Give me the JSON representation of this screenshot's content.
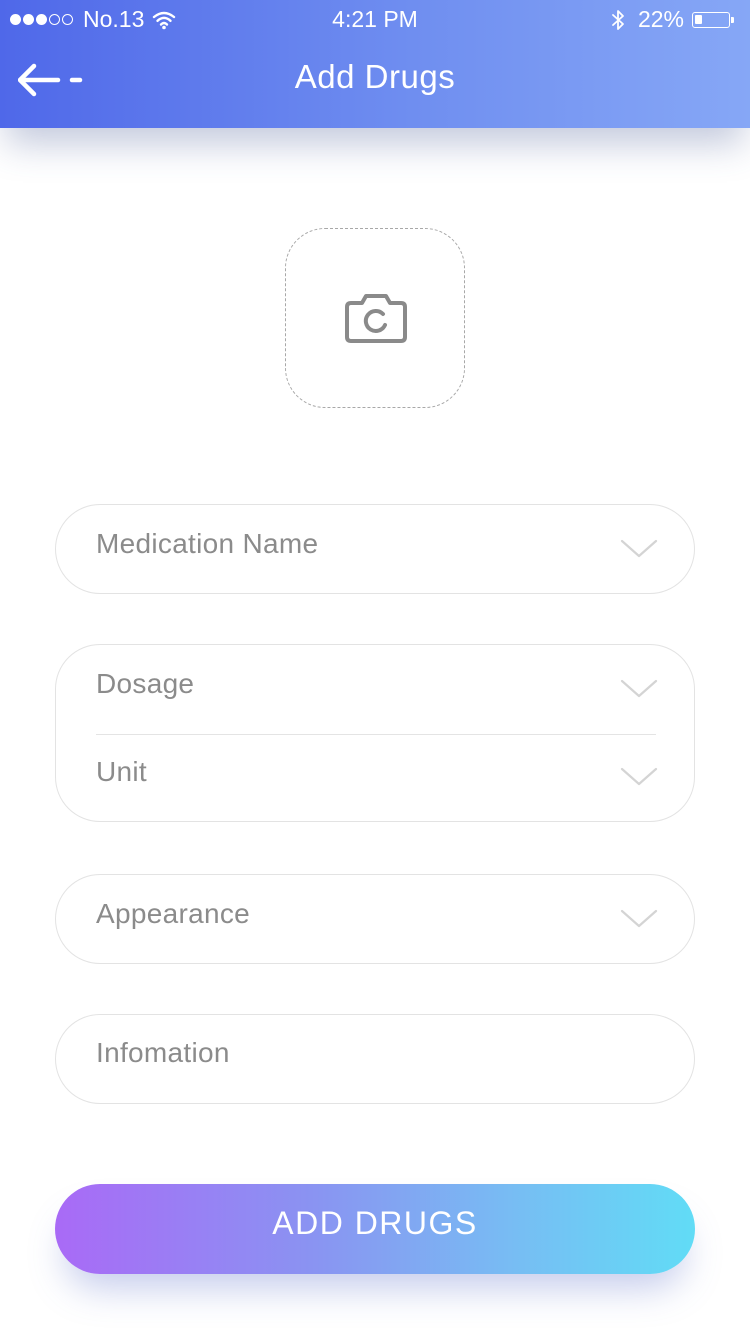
{
  "status_bar": {
    "carrier": "No.13",
    "time": "4:21 PM",
    "battery_percent": "22%",
    "battery_level": 0.22,
    "signal_bars_filled": 3,
    "signal_bars_total": 5
  },
  "header": {
    "title": "Add Drugs",
    "back_icon": "arrow-left-icon",
    "gradient_start": "#4f68e9",
    "gradient_end": "#86a7f6"
  },
  "photo_upload": {
    "icon": "camera-icon"
  },
  "form": {
    "medication_name": {
      "placeholder": "Medication Name",
      "icon": "chevron-down-icon"
    },
    "dosage": {
      "placeholder": "Dosage",
      "icon": "chevron-down-icon"
    },
    "unit": {
      "placeholder": "Unit",
      "icon": "chevron-down-icon"
    },
    "appearance": {
      "placeholder": "Appearance",
      "icon": "chevron-down-icon"
    },
    "information": {
      "placeholder": "Infomation"
    }
  },
  "submit": {
    "label": "ADD DRUGS",
    "gradient_start": "#a96af6",
    "gradient_end": "#61dcf6"
  }
}
